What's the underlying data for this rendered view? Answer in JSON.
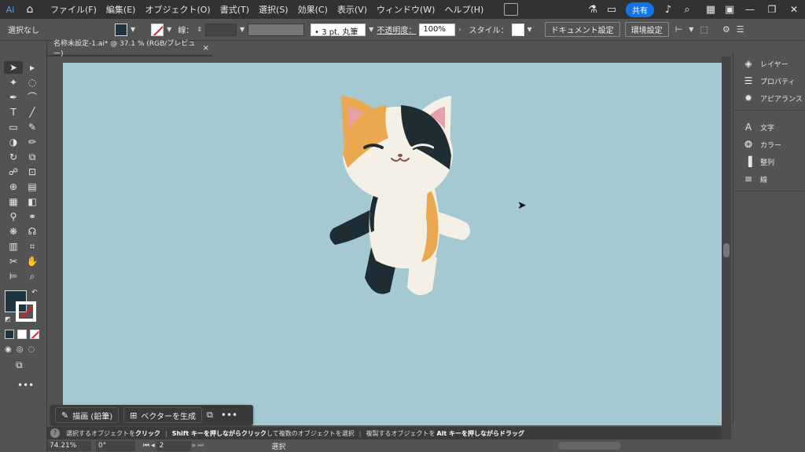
{
  "app": {
    "logo": "Ai",
    "home_icon": "home-icon"
  },
  "menu": [
    "ファイル(F)",
    "編集(E)",
    "オブジェクト(O)",
    "書式(T)",
    "選択(S)",
    "効果(C)",
    "表示(V)",
    "ウィンドウ(W)",
    "ヘルプ(H)"
  ],
  "topright": {
    "share_label": "共有"
  },
  "control": {
    "selection_status": "選択なし",
    "stroke_label": "線：",
    "brush_value": "3 pt. 丸筆",
    "opacity_label": "不透明度：",
    "opacity_value": "100%",
    "style_label": "スタイル：",
    "document_settings": "ドキュメント設定",
    "preferences": "環境設定"
  },
  "document": {
    "tab_title": "名称未設定-1.ai* @ 37.1 % (RGB/プレビュー)",
    "close": "×"
  },
  "panel": {
    "group1": [
      {
        "icon": "layers-icon",
        "label": "レイヤー"
      },
      {
        "icon": "properties-icon",
        "label": "プロパティ"
      },
      {
        "icon": "appearance-icon",
        "label": "アピアランス"
      }
    ],
    "group2": [
      {
        "icon": "character-icon",
        "label": "文字"
      },
      {
        "icon": "color-icon",
        "label": "カラー"
      },
      {
        "icon": "align-icon",
        "label": "整列"
      },
      {
        "icon": "stroke-icon",
        "label": "線"
      }
    ]
  },
  "taskbar": {
    "draw_pencil": "描画 (鉛筆)",
    "generate_vector": "ベクターを生成"
  },
  "hint": {
    "part1": "選択するオブジェクトを",
    "click": "クリック",
    "shift_key": "Shift キーを押しながらクリック",
    "part2": "して複数のオブジェクトを選択",
    "part3": "複製するオブジェクトを",
    "alt_key": "Alt キーを押しながらドラッグ"
  },
  "status": {
    "zoom": "74.21%",
    "rotation": "0°",
    "page": "2",
    "tool": "選択"
  },
  "colors": {
    "artboard": "#a5c9d1",
    "fill": "#1e3440",
    "accent": "#1473e6"
  }
}
